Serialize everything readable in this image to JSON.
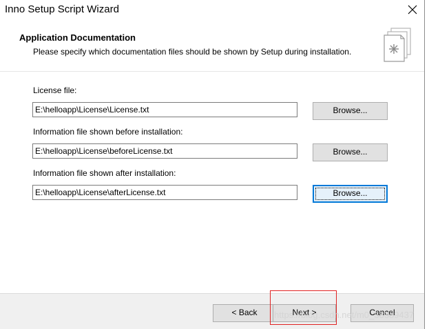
{
  "window": {
    "title": "Inno Setup Script Wizard",
    "close_icon": "close-icon"
  },
  "header": {
    "title": "Application Documentation",
    "description": "Please specify which documentation files should be shown by Setup during installation.",
    "icon": "document-wizard-icon"
  },
  "fields": [
    {
      "label": "License file:",
      "value": "E:\\helloapp\\License\\License.txt",
      "browse_label": "Browse..."
    },
    {
      "label": "Information file shown before installation:",
      "value": "E:\\helloapp\\License\\beforeLicense.txt",
      "browse_label": "Browse..."
    },
    {
      "label": "Information file shown after installation:",
      "value": "E:\\helloapp\\License\\afterLicense.txt",
      "browse_label": "Browse..."
    }
  ],
  "footer": {
    "back_label": "< Back",
    "next_label": "Next >",
    "cancel_label": "Cancel"
  },
  "watermark": "https://blog.csdn.net/m0_38389437",
  "colors": {
    "focus_border": "#0078d7",
    "annotation_box": "#e02020"
  }
}
